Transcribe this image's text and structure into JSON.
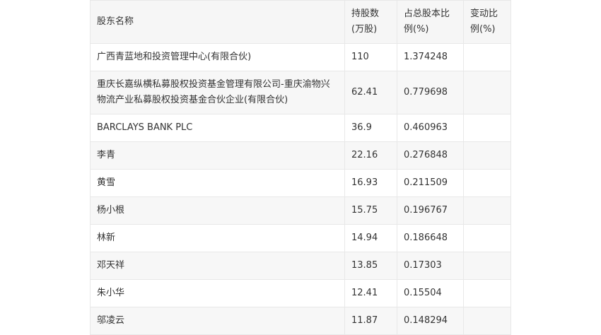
{
  "table": {
    "headers": [
      "股东名称",
      "持股数(万股)",
      "占总股本比例(%)",
      "变动比例(%)"
    ],
    "rows": [
      [
        "广西青蓝地和投资管理中心(有限合伙)",
        "110",
        "1.374248",
        ""
      ],
      [
        "重庆长嘉纵横私募股权投资基金管理有限公司-重庆渝物兴物流产业私募股权投资基金合伙企业(有限合伙)",
        "62.41",
        "0.779698",
        ""
      ],
      [
        "BARCLAYS BANK PLC",
        "36.9",
        "0.460963",
        ""
      ],
      [
        "李青",
        "22.16",
        "0.276848",
        ""
      ],
      [
        "黄雪",
        "16.93",
        "0.211509",
        ""
      ],
      [
        "杨小根",
        "15.75",
        "0.196767",
        ""
      ],
      [
        "林新",
        "14.94",
        "0.186648",
        ""
      ],
      [
        "邓天祥",
        "13.85",
        "0.17303",
        ""
      ],
      [
        "朱小华",
        "12.41",
        "0.15504",
        ""
      ],
      [
        "邬凌云",
        "11.87",
        "0.148294",
        ""
      ]
    ]
  }
}
